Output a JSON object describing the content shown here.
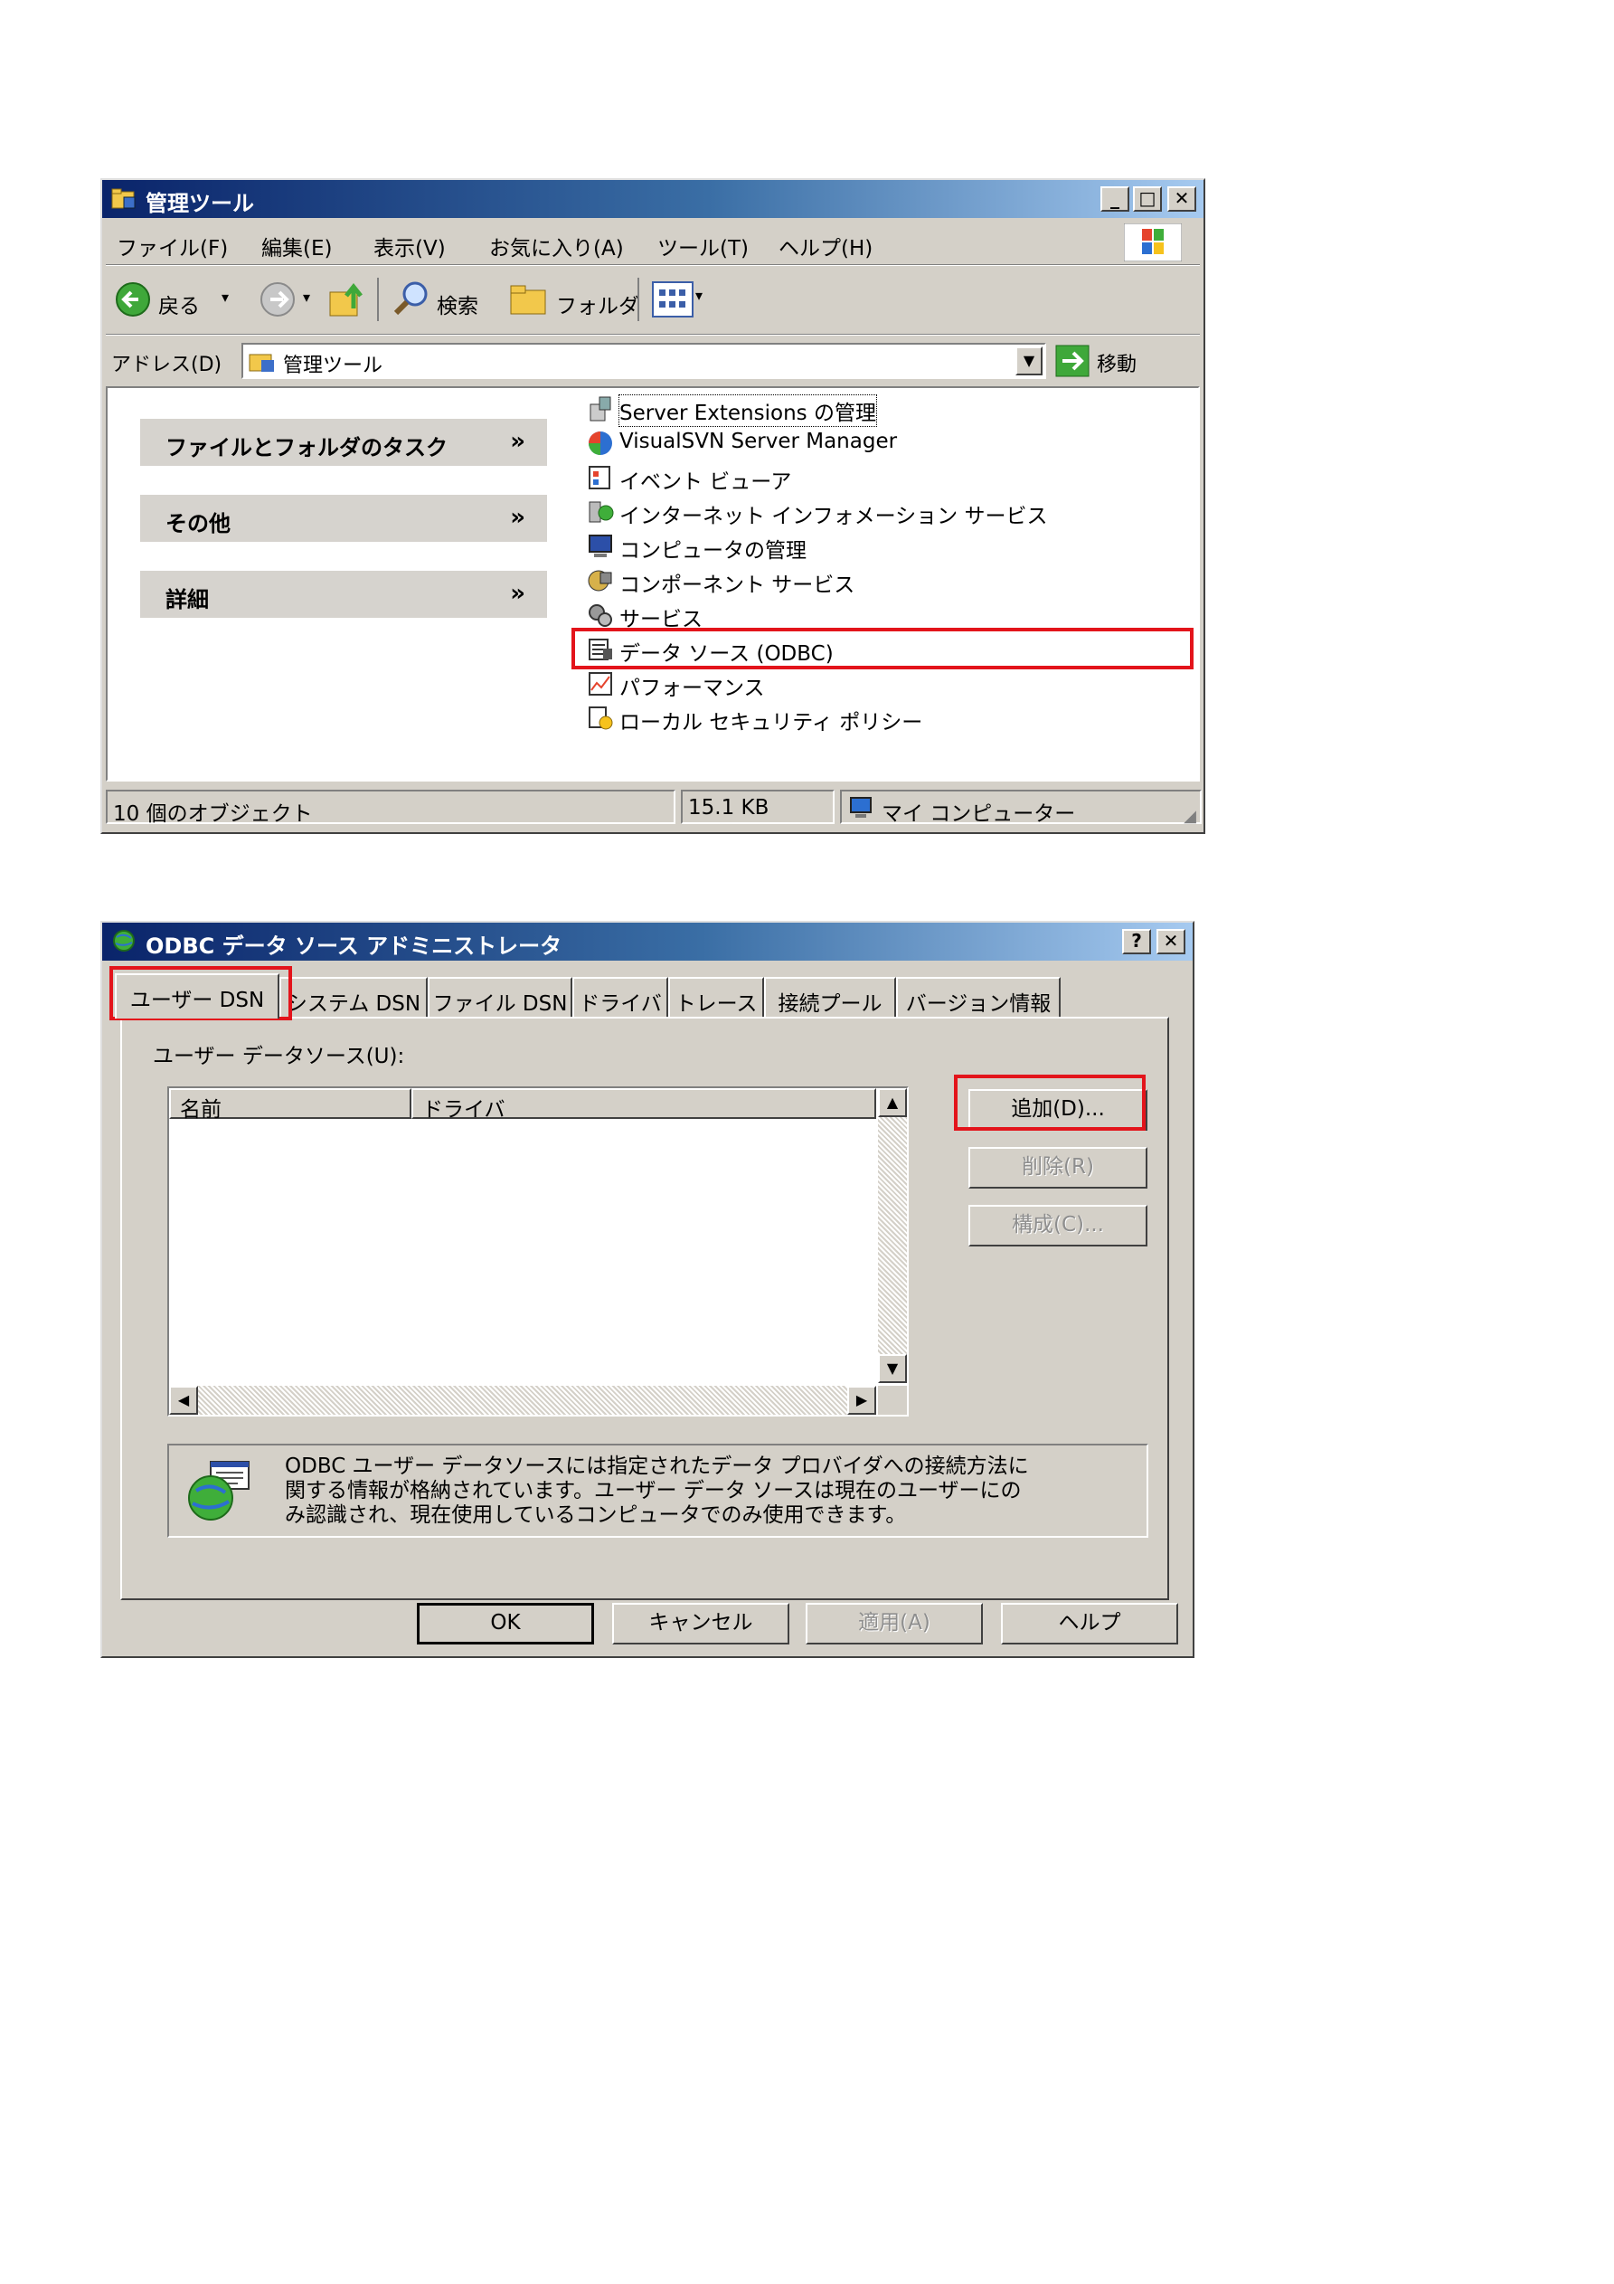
{
  "explorer": {
    "title": "管理ツール",
    "menu": [
      "ファイル(F)",
      "編集(E)",
      "表示(V)",
      "お気に入り(A)",
      "ツール(T)",
      "ヘルプ(H)"
    ],
    "toolbar": {
      "back_label": "戻る",
      "search_label": "検索",
      "folders_label": "フォルダ"
    },
    "address": {
      "label": "アドレス(D)",
      "value": "管理ツール",
      "go_label": "移動"
    },
    "task_panels": [
      "ファイルとフォルダのタスク",
      "その他",
      "詳細"
    ],
    "items": [
      {
        "label": "Server Extensions の管理",
        "icon": "server-extensions-icon"
      },
      {
        "label": "VisualSVN Server Manager",
        "icon": "visualsvn-icon"
      },
      {
        "label": "イベント ビューア",
        "icon": "event-viewer-icon"
      },
      {
        "label": "インターネット インフォメーション サービス",
        "icon": "iis-icon"
      },
      {
        "label": "コンピュータの管理",
        "icon": "computer-management-icon"
      },
      {
        "label": "コンポーネント サービス",
        "icon": "component-services-icon"
      },
      {
        "label": "サービス",
        "icon": "services-icon"
      },
      {
        "label": "データ ソース (ODBC)",
        "icon": "odbc-icon"
      },
      {
        "label": "パフォーマンス",
        "icon": "performance-icon"
      },
      {
        "label": "ローカル セキュリティ ポリシー",
        "icon": "local-security-policy-icon"
      }
    ],
    "status": {
      "count": "10 個のオブジェクト",
      "size": "15.1 KB",
      "location": "マイ コンピューター"
    }
  },
  "odbc": {
    "title": "ODBC データ ソース アドミニストレータ",
    "tabs": [
      "ユーザー DSN",
      "システム DSN",
      "ファイル DSN",
      "ドライバ",
      "トレース",
      "接続プール",
      "バージョン情報"
    ],
    "list_label": "ユーザー データソース(U):",
    "columns": [
      "名前",
      "ドライバ"
    ],
    "side_buttons": {
      "add": "追加(D)...",
      "remove": "削除(R)",
      "configure": "構成(C)..."
    },
    "info_lines": [
      "ODBC ユーザー データソースには指定されたデータ プロバイダへの接続方法に",
      "関する情報が格納されています。ユーザー データ ソースは現在のユーザーにの",
      "み認識され、現在使用しているコンピュータでのみ使用できます。"
    ],
    "footer_buttons": {
      "ok": "OK",
      "cancel": "キャンセル",
      "apply": "適用(A)",
      "help": "ヘルプ"
    }
  },
  "colors": {
    "highlight": "#e3141b",
    "titlebar_start": "#0a246a",
    "titlebar_end": "#a6caf0",
    "face": "#d4d0c8"
  }
}
